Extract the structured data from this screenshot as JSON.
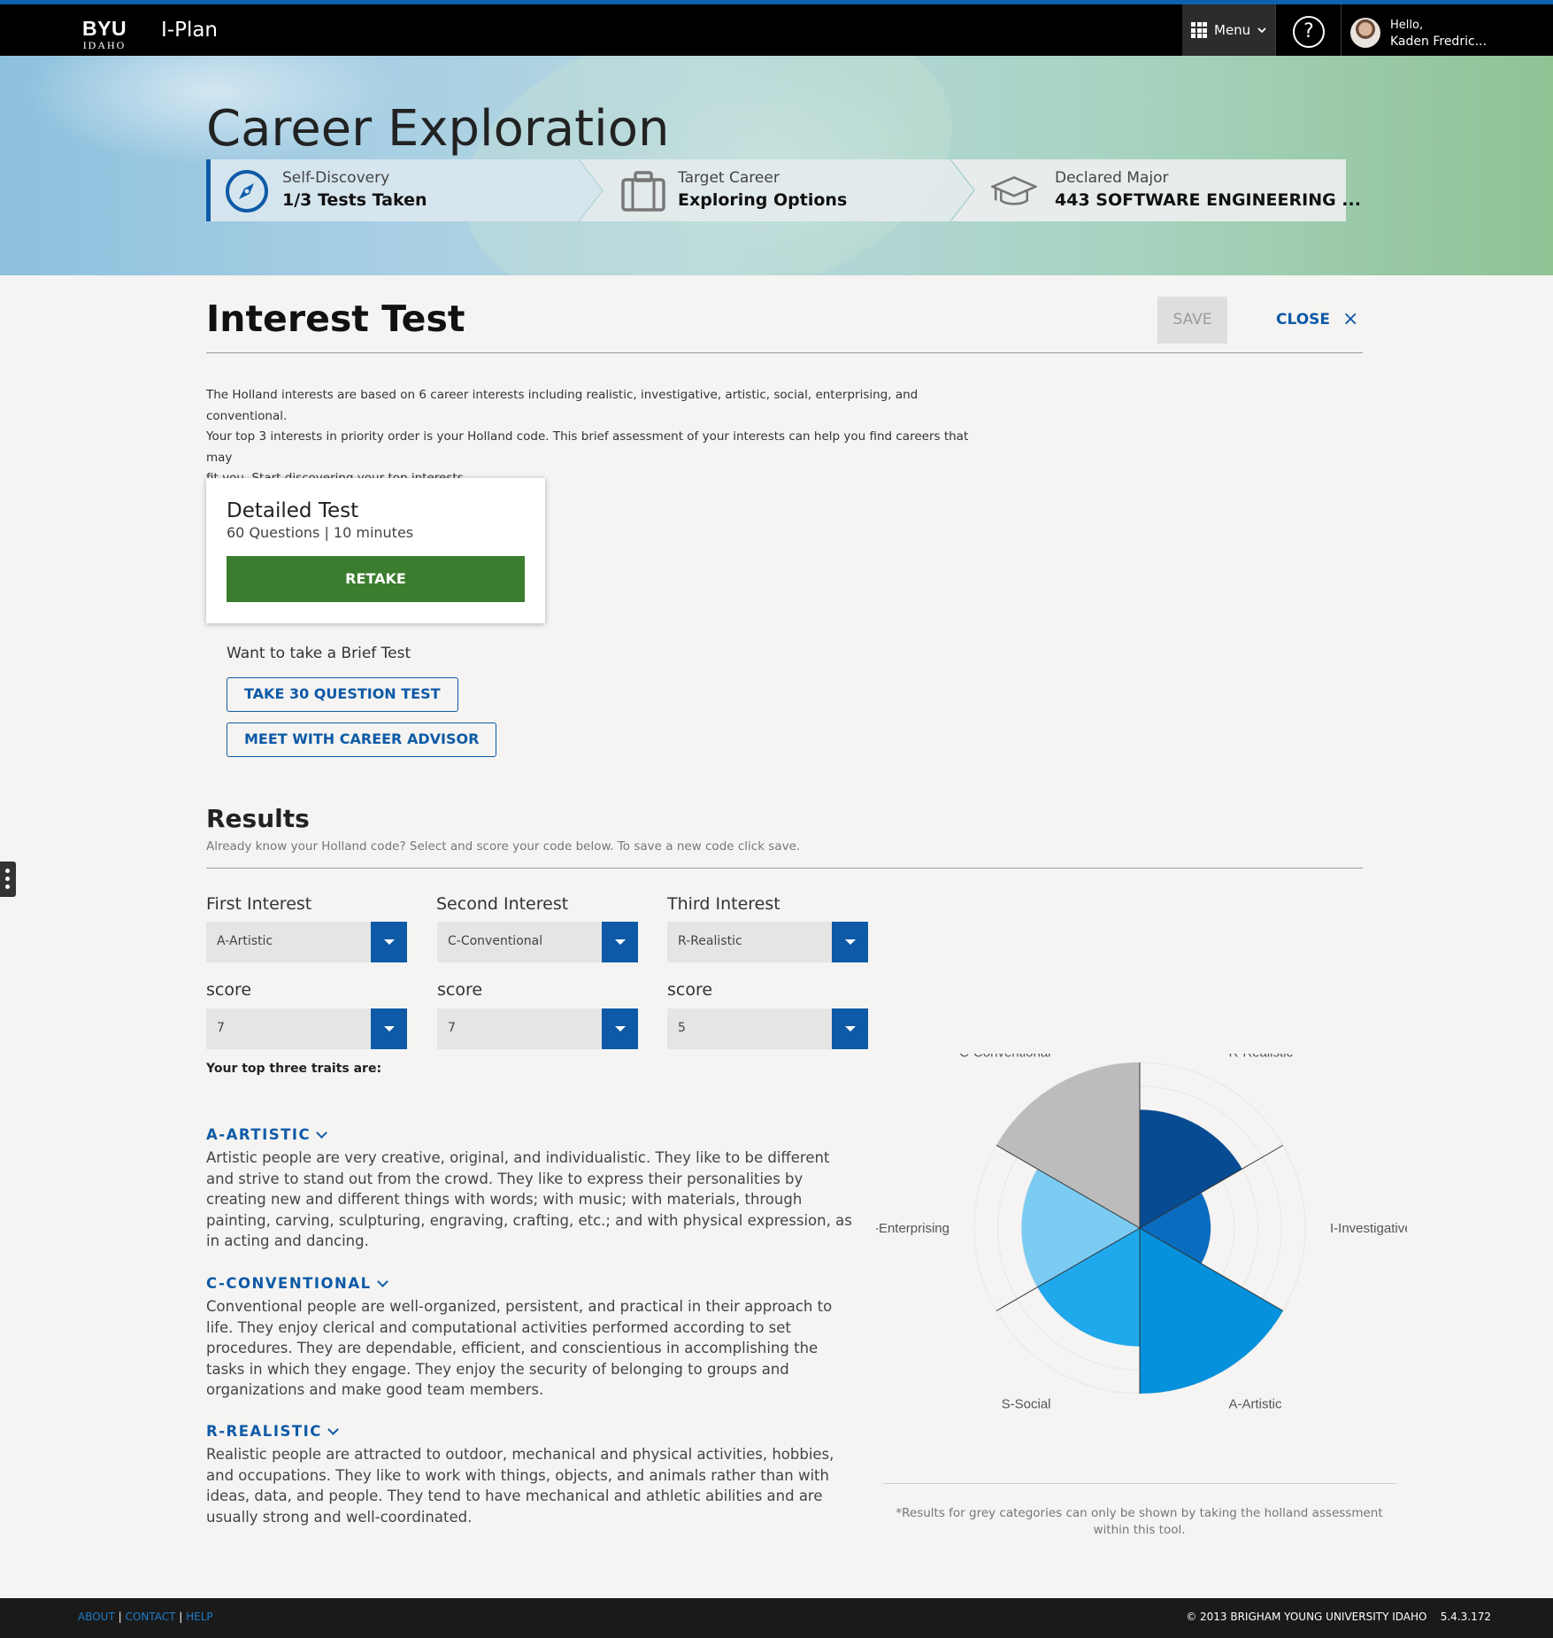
{
  "header": {
    "logo_top": "BYU",
    "logo_bottom": "IDAHO",
    "app_title": "I-Plan",
    "menu_label": "Menu",
    "help_glyph": "?",
    "greeting": "Hello,",
    "user_name": "Kaden Fredric..."
  },
  "hero": {
    "title": "Career Exploration",
    "steps": [
      {
        "label": "Self-Discovery",
        "value": "1/3 Tests Taken",
        "icon": "compass-icon"
      },
      {
        "label": "Target Career",
        "value": "Exploring Options",
        "icon": "briefcase-icon"
      },
      {
        "label": "Declared Major",
        "value": "443 SOFTWARE ENGINEERING ...",
        "icon": "graduation-cap-icon"
      }
    ]
  },
  "section": {
    "title": "Interest Test",
    "save_label": "SAVE",
    "close_label": "CLOSE",
    "close_glyph": "×",
    "intro_lines": [
      "The Holland interests are based on 6 career interests including realistic, investigative, artistic, social, enterprising, and conventional.",
      "Your top 3 interests in priority order is your Holland code. This brief assessment of your interests can help you find careers that may",
      "fit you. Start discovering your top interests."
    ]
  },
  "test_card": {
    "title": "Detailed Test",
    "questions": "60 Questions",
    "separator": "|",
    "duration": "10 minutes",
    "retake_label": "RETAKE"
  },
  "brief": {
    "label": "Want to take a Brief Test",
    "take_test_label": "TAKE 30 QUESTION TEST",
    "advisor_label": "MEET WITH CAREER ADVISOR"
  },
  "results": {
    "title": "Results",
    "subtitle": "Already know your Holland code? Select and score your code below. To save a new code click save.",
    "interests": [
      {
        "label": "First Interest",
        "value": "A-Artistic",
        "score_label": "score",
        "score": "7"
      },
      {
        "label": "Second Interest",
        "value": "C-Conventional",
        "score_label": "score",
        "score": "7"
      },
      {
        "label": "Third Interest",
        "value": "R-Realistic",
        "score_label": "score",
        "score": "5"
      }
    ],
    "traits_heading": "Your top three traits are:",
    "traits": [
      {
        "name": "A-ARTISTIC",
        "description": "Artistic people are very creative, original, and individualistic. They like to be different and strive to stand out from the crowd. They like to express their personalities by creating new and different things with words; with music; with materials, through painting, carving, sculpturing, engraving, crafting, etc.; and with physical expression, as in acting and dancing."
      },
      {
        "name": "C-CONVENTIONAL",
        "description": "Conventional people are well-organized, persistent, and practical in their approach to life. They enjoy clerical and computational activities performed according to set procedures. They are dependable, efficient, and conscientious in accomplishing the tasks in which they engage. They enjoy the security of belonging to groups and organizations and make good team members."
      },
      {
        "name": "R-REALISTIC",
        "description": "Realistic people are attracted to outdoor, mechanical and physical activities, hobbies, and occupations. They like to work with things, objects, and animals rather than with ideas, data, and people. They tend to have mechanical and athletic abilities and are usually strong and well-coordinated."
      }
    ],
    "footnote": "*Results for grey categories can only be shown by taking the holland assessment within this tool."
  },
  "chart_data": {
    "type": "polar-area",
    "categories": [
      "R-Realistic",
      "I-Investigative",
      "A-Artistic",
      "S-Social",
      "E-Enterprising",
      "C-Conventional"
    ],
    "values": [
      5,
      3,
      7,
      5,
      5,
      7
    ],
    "max": 7,
    "grey_categories": [
      "C-Conventional"
    ],
    "colors": [
      "#074b92",
      "#0a6cbf",
      "#0591dc",
      "#1fa9ec",
      "#7ccbf3",
      "#bcbcbc"
    ]
  },
  "footer": {
    "links": [
      "ABOUT",
      "CONTACT",
      "HELP"
    ],
    "link_separator": "|",
    "copyright": "© 2013 BRIGHAM YOUNG UNIVERSITY IDAHO",
    "version": "5.4.3.172"
  }
}
